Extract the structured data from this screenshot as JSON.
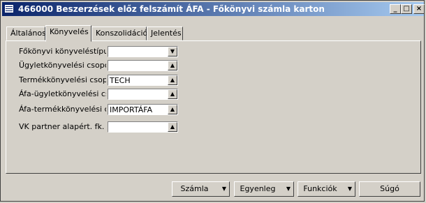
{
  "window": {
    "title": "466000 Beszerzések előz felszámít ÁFA - Főkönyvi számla karton",
    "buttons": {
      "minimize": "_",
      "maximize": "□",
      "close": "×"
    }
  },
  "tabs": [
    {
      "label": "Általános"
    },
    {
      "label": "Könyvelés"
    },
    {
      "label": "Konszolidáció"
    },
    {
      "label": "Jelentés"
    }
  ],
  "fields": [
    {
      "label": "Főkönyvi könyveléstípus",
      "value": "",
      "control": "dropdown"
    },
    {
      "label": "Ügyletkönyvelési csoport",
      "value": "",
      "control": "lookup"
    },
    {
      "label": "Termékkönyvelési csoport",
      "value": "TECH",
      "control": "lookup"
    },
    {
      "label": "Áfa-ügyletkönyvelési csoport",
      "value": "",
      "control": "lookup"
    },
    {
      "label": "Áfa-termékkönyvelési csoport",
      "value": "IMPORTÁFA",
      "control": "lookup"
    },
    {
      "label": "VK partner alapért. fk. szla",
      "value": "",
      "control": "lookup"
    }
  ],
  "footer": {
    "szamla": "Számla",
    "egyenleg": "Egyenleg",
    "funkciok": "Funkciók",
    "sugo": "Súgó"
  },
  "icons": {
    "dropdown": "chevron-down-icon",
    "lookup": "arrow-up-icon"
  }
}
